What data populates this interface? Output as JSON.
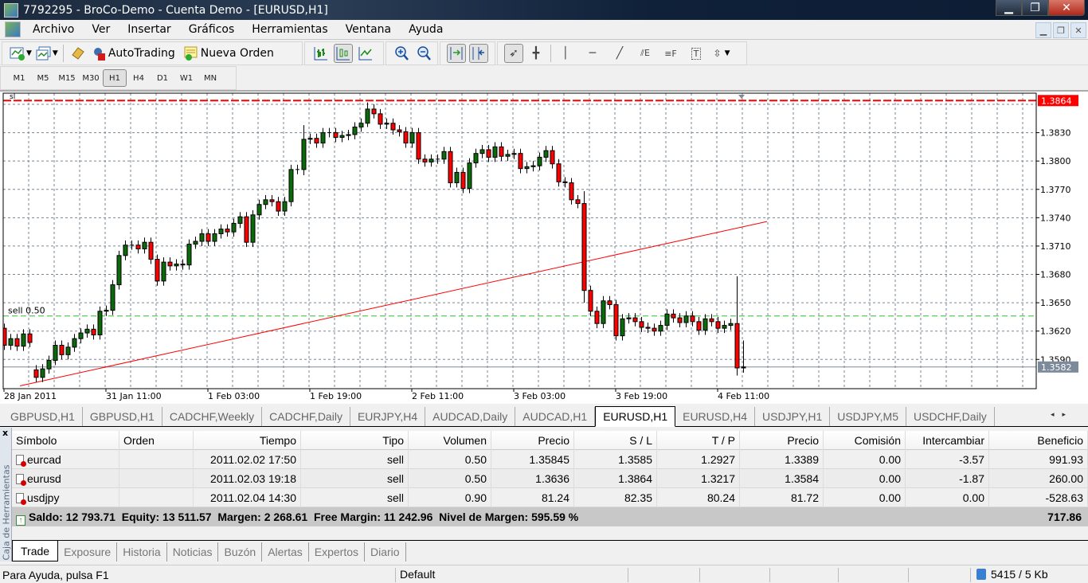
{
  "window": {
    "title": "7792295 - BroCo-Demo - Cuenta Demo - [EURUSD,H1]"
  },
  "menu": [
    "Archivo",
    "Ver",
    "Insertar",
    "Gráficos",
    "Herramientas",
    "Ventana",
    "Ayuda"
  ],
  "toolbar": {
    "autotrading": "AutoTrading",
    "new_order": "Nueva Orden"
  },
  "timeframes": {
    "items": [
      "M1",
      "M5",
      "M15",
      "M30",
      "H1",
      "H4",
      "D1",
      "W1",
      "MN"
    ],
    "active": "H1"
  },
  "chart": {
    "symbol": "EURUSD",
    "period": "H1",
    "sl_label": "sl",
    "order_label": "sell 0.50",
    "colors": {
      "bull": "#0b6b0b",
      "bear": "#ff0000",
      "grid": "#7a8696",
      "sl_line": "#ff0000",
      "order_line": "#2fbf2f",
      "trendline": "#ff0000",
      "bid_line": "#7d8a99"
    }
  },
  "chart_data": {
    "type": "candlestick",
    "price_ticks": [
      "1.3830",
      "1.3800",
      "1.3770",
      "1.3740",
      "1.3710",
      "1.3680",
      "1.3650",
      "1.3620",
      "1.3590"
    ],
    "price_tick_values": [
      1.383,
      1.38,
      1.377,
      1.374,
      1.371,
      1.368,
      1.365,
      1.362,
      1.359
    ],
    "ylim": [
      1.3553,
      1.3872
    ],
    "time_labels": [
      "28 Jan 2011",
      "31 Jan 11:00",
      "1 Feb 03:00",
      "1 Feb 19:00",
      "2 Feb 11:00",
      "3 Feb 03:00",
      "3 Feb 19:00",
      "4 Feb 11:00"
    ],
    "time_label_every": 16,
    "first_open": 1.3623,
    "open_gaps": {
      "5": 1.3579
    },
    "closes": [
      1.3605,
      1.3612,
      1.3604,
      1.3617,
      1.3608,
      1.3571,
      1.358,
      1.3589,
      1.3605,
      1.3595,
      1.3603,
      1.3612,
      1.3618,
      1.3622,
      1.3616,
      1.3641,
      1.3642,
      1.3669,
      1.37,
      1.3711,
      1.3711,
      1.3707,
      1.3714,
      1.3696,
      1.3673,
      1.3693,
      1.3689,
      1.3691,
      1.369,
      1.3712,
      1.3715,
      1.3723,
      1.3715,
      1.3723,
      1.3728,
      1.3725,
      1.3734,
      1.3741,
      1.3714,
      1.3743,
      1.3754,
      1.3759,
      1.3757,
      1.3747,
      1.3757,
      1.3791,
      1.3791,
      1.3823,
      1.3824,
      1.3819,
      1.383,
      1.383,
      1.3825,
      1.3827,
      1.3828,
      1.3836,
      1.384,
      1.3855,
      1.385,
      1.3839,
      1.384,
      1.3833,
      1.3831,
      1.3819,
      1.383,
      1.3802,
      1.3799,
      1.3802,
      1.3802,
      1.381,
      1.3777,
      1.3788,
      1.3771,
      1.3798,
      1.3808,
      1.3812,
      1.3804,
      1.3815,
      1.3805,
      1.3807,
      1.3808,
      1.3792,
      1.3794,
      1.3795,
      1.3804,
      1.3811,
      1.3797,
      1.3778,
      1.3777,
      1.3759,
      1.3755,
      1.3663,
      1.3641,
      1.3628,
      1.3652,
      1.3648,
      1.3615,
      1.3633,
      1.3634,
      1.363,
      1.3624,
      1.3623,
      1.362,
      1.3626,
      1.3638,
      1.3634,
      1.3629,
      1.3636,
      1.363,
      1.3621,
      1.3633,
      1.363,
      1.3623,
      1.3626,
      1.3628,
      1.3581,
      1.3582
    ],
    "wick_default": 0.0005,
    "wick_overrides": {
      "91": [
        1.3768,
        1.365
      ],
      "115": [
        1.3678,
        1.3573
      ],
      "116": [
        1.361,
        1.3576
      ],
      "57": [
        1.3862,
        1.3836
      ],
      "47": [
        1.3838,
        1.3785
      ]
    },
    "sl_price": 1.3864,
    "sl_price_label": "1.3864",
    "order_price": 1.3636,
    "bid_price": 1.3582,
    "bid_label": "1.3582",
    "top_hidden_tick": 1.386,
    "trendline": {
      "start_index": 2.5,
      "start_price": 1.3562,
      "end_index": 119.75,
      "end_price": 1.3736
    }
  },
  "chart_tabs": {
    "items": [
      "GBPUSD,H1",
      "GBPUSD,H1",
      "CADCHF,Weekly",
      "CADCHF,Daily",
      "EURJPY,H4",
      "AUDCAD,Daily",
      "AUDCAD,H1",
      "EURUSD,H1",
      "EURUSD,H4",
      "USDJPY,H1",
      "USDJPY,M5",
      "USDCHF,Daily"
    ],
    "active": 7
  },
  "terminal": {
    "side_label": "Caja de Herramientas",
    "close": "x",
    "columns": [
      "Símbolo",
      "Orden",
      "Tiempo",
      "Tipo",
      "Volumen",
      "Precio",
      "S / L",
      "T / P",
      "Precio",
      "Comisión",
      "Intercambiar",
      "Beneficio"
    ],
    "sort_indicator": "⁄",
    "rows": [
      [
        "eurcad",
        "",
        "2011.02.02 17:50",
        "sell",
        "0.50",
        "1.35845",
        "1.3585",
        "1.2927",
        "1.3389",
        "0.00",
        "-3.57",
        "991.93"
      ],
      [
        "eurusd",
        "",
        "2011.02.03 19:18",
        "sell",
        "0.50",
        "1.3636",
        "1.3864",
        "1.3217",
        "1.3584",
        "0.00",
        "-1.87",
        "260.00"
      ],
      [
        "usdjpy",
        "",
        "2011.02.04 14:30",
        "sell",
        "0.90",
        "81.24",
        "82.35",
        "80.24",
        "81.72",
        "0.00",
        "0.00",
        "-528.63"
      ]
    ],
    "summary": "Saldo: 12 793.71  Equity: 13 511.57  Margen: 2 268.61  Free Margin: 11 242.96  Nivel de Margen: 595.59 %",
    "total": "717.86",
    "tabs": [
      "Trade",
      "Exposure",
      "Historia",
      "Noticias",
      "Buzón",
      "Alertas",
      "Expertos",
      "Diario"
    ],
    "active_tab": 0
  },
  "status": {
    "help": "Para Ayuda, pulsa F1",
    "profile": "Default",
    "traffic": "5415 / 5 Kb"
  }
}
